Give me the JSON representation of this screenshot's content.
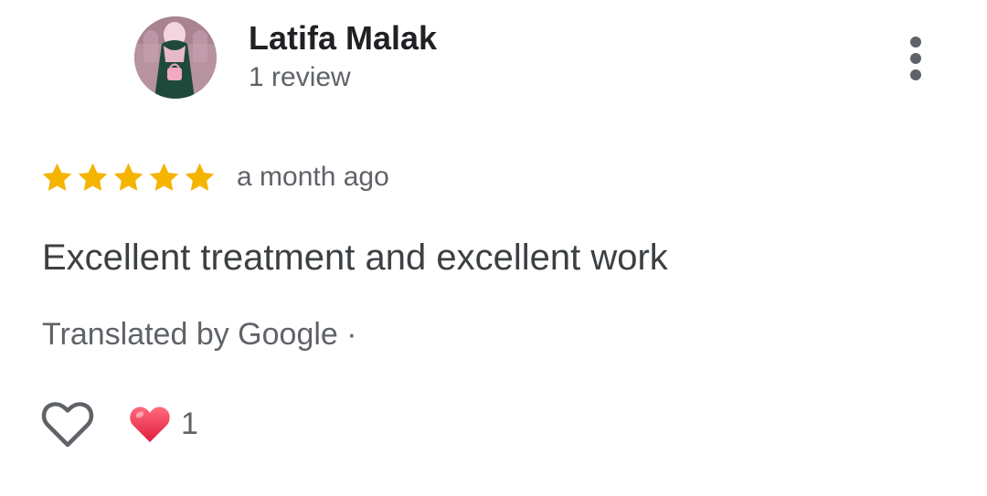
{
  "review": {
    "author": {
      "name": "Latifa Malak",
      "review_count": "1 review"
    },
    "rating": {
      "stars": 5,
      "max": 5
    },
    "time": "a month ago",
    "text": "Excellent treatment and excellent work",
    "translation_note": "Translated by Google ·",
    "reactions": {
      "count": "1",
      "icon": "red-heart-emoji"
    },
    "icons": {
      "menu": "more-vertical-icon",
      "like": "heart-outline-icon",
      "star": "star-icon"
    },
    "colors": {
      "star": "#f4b400",
      "heart": "#e8344e",
      "text_primary": "#202124",
      "text_secondary": "#5f6368"
    }
  }
}
